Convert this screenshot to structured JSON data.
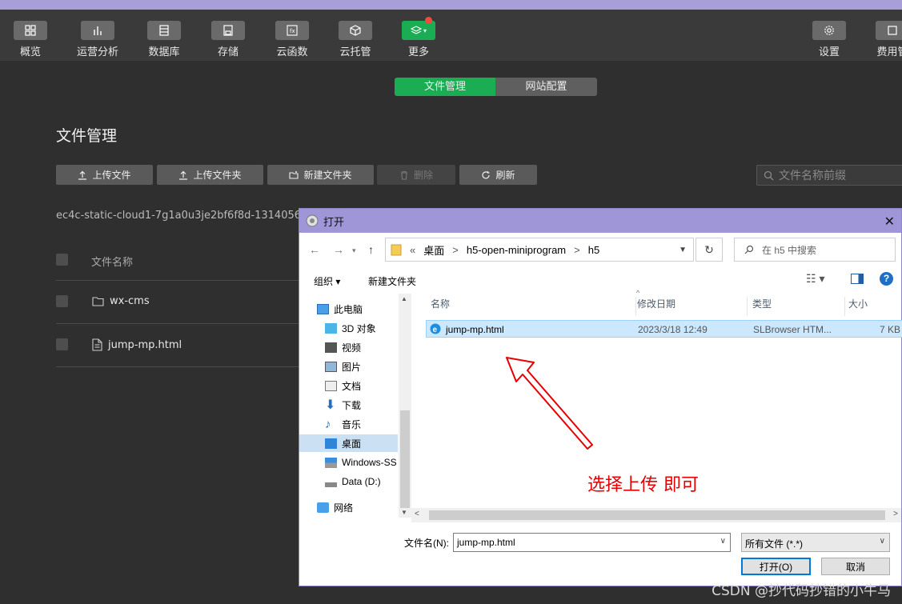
{
  "toolbar": {
    "items": [
      {
        "label": "概览",
        "icon": "overview-icon"
      },
      {
        "label": "运营分析",
        "icon": "analytics-icon"
      },
      {
        "label": "数据库",
        "icon": "database-icon"
      },
      {
        "label": "存储",
        "icon": "storage-icon"
      },
      {
        "label": "云函数",
        "icon": "function-icon"
      },
      {
        "label": "云托管",
        "icon": "cloud-hosting-icon"
      },
      {
        "label": "更多",
        "icon": "layers-icon"
      },
      {
        "label": "设置",
        "icon": "gear-icon"
      },
      {
        "label": "费用管",
        "icon": "billing-icon"
      }
    ]
  },
  "tabs": {
    "file_mgmt": "文件管理",
    "site_config": "网站配置"
  },
  "page": {
    "title": "文件管理",
    "buttons": {
      "upload_file": "上传文件",
      "upload_folder": "上传文件夹",
      "new_folder": "新建文件夹",
      "delete": "删除",
      "refresh": "刷新"
    },
    "search_placeholder": "文件名称前缀",
    "path": "ec4c-static-cloud1-7g1a0u3je2bf6f8d-1314056523",
    "column_header": "文件名称",
    "files": [
      {
        "name": "wx-cms",
        "type": "folder"
      },
      {
        "name": "jump-mp.html",
        "type": "file"
      }
    ]
  },
  "dialog": {
    "title": "打开",
    "breadcrumb": [
      "«",
      "桌面",
      ">",
      "h5-open-miniprogram",
      ">",
      "h5"
    ],
    "search_placeholder": "在 h5 中搜索",
    "organize": "组织",
    "new_folder": "新建文件夹",
    "nav": [
      {
        "label": "此电脑",
        "icon": "computer-icon"
      },
      {
        "label": "3D 对象",
        "icon": "3d-objects-icon"
      },
      {
        "label": "视频",
        "icon": "video-icon"
      },
      {
        "label": "图片",
        "icon": "pictures-icon"
      },
      {
        "label": "文档",
        "icon": "documents-icon"
      },
      {
        "label": "下载",
        "icon": "download-icon"
      },
      {
        "label": "音乐",
        "icon": "music-icon"
      },
      {
        "label": "桌面",
        "icon": "desktop-icon"
      },
      {
        "label": "Windows-SS",
        "icon": "drive-icon"
      },
      {
        "label": "Data (D:)",
        "icon": "drive-icon"
      },
      {
        "label": "网络",
        "icon": "network-icon"
      }
    ],
    "columns": {
      "name": "名称",
      "date": "修改日期",
      "type": "类型",
      "size": "大小"
    },
    "row": {
      "name": "jump-mp.html",
      "date": "2023/3/18 12:49",
      "type": "SLBrowser HTM...",
      "size": "7 KB"
    },
    "filename_label": "文件名(N):",
    "filename_value": "jump-mp.html",
    "filter": "所有文件 (*.*)",
    "open": "打开(O)",
    "cancel": "取消"
  },
  "annotation": "选择上传 即可",
  "watermark": "CSDN @抄代码抄错的小牛马",
  "colors": {
    "accent": "#1aad54",
    "annotation": "#e60000",
    "dialog_title": "#9f96d7"
  }
}
